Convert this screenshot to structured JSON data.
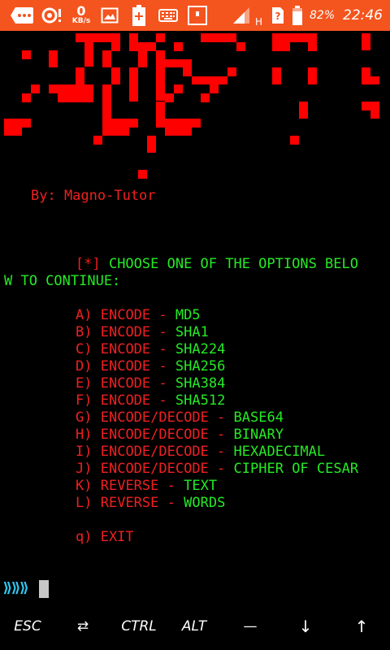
{
  "status_bar": {
    "net_speed_value": "0",
    "net_speed_unit": "KB/s",
    "network_type": "H",
    "battery_percent": "82%",
    "time": "22:46",
    "icons": [
      "messages-icon",
      "sync-alert-icon",
      "gallery-icon",
      "battery-saver-icon",
      "keyboard-icon",
      "screenshot-icon",
      "signal-icon",
      "sim-unknown-icon",
      "battery-icon"
    ]
  },
  "banner": {
    "color": "#ff0000",
    "description_icon": "ascii-art-logo"
  },
  "terminal": {
    "author": "By: Magno-Tutor",
    "prompt_prefix": "[*]",
    "prompt_line1": " CHOOSE ONE OF THE OPTIONS BELO",
    "prompt_line2": "W TO CONTINUE:",
    "options": [
      {
        "key": "A)",
        "action": "ENCODE",
        "sep": "-",
        "target": "MD5"
      },
      {
        "key": "B)",
        "action": "ENCODE",
        "sep": "-",
        "target": "SHA1"
      },
      {
        "key": "C)",
        "action": "ENCODE",
        "sep": "-",
        "target": "SHA224"
      },
      {
        "key": "D)",
        "action": "ENCODE",
        "sep": "-",
        "target": "SHA256"
      },
      {
        "key": "E)",
        "action": "ENCODE",
        "sep": "-",
        "target": "SHA384"
      },
      {
        "key": "F)",
        "action": "ENCODE",
        "sep": "-",
        "target": "SHA512"
      },
      {
        "key": "G)",
        "action": "ENCODE/DECODE",
        "sep": "-",
        "target": "BASE64"
      },
      {
        "key": "H)",
        "action": "ENCODE/DECODE",
        "sep": "-",
        "target": "BINARY"
      },
      {
        "key": "I)",
        "action": "ENCODE/DECODE",
        "sep": "-",
        "target": "HEXADECIMAL"
      },
      {
        "key": "J)",
        "action": "ENCODE/DECODE",
        "sep": "-",
        "target": "CIPHER OF CESAR"
      },
      {
        "key": "K)",
        "action": "REVERSE",
        "sep": "-",
        "target": "TEXT"
      },
      {
        "key": "L)",
        "action": "REVERSE",
        "sep": "-",
        "target": "WORDS"
      }
    ],
    "exit_option": "q) EXIT",
    "input_prompt": "⟫⟫⟫",
    "colors": {
      "red": "#ef2020",
      "green": "#25ea25",
      "cyan": "#2fc8f0",
      "background": "#000000"
    }
  },
  "extra_keys": {
    "esc": "ESC",
    "tab": "⇄",
    "ctrl": "CTRL",
    "alt": "ALT",
    "dash": "—",
    "down": "↓",
    "up": "↑"
  }
}
